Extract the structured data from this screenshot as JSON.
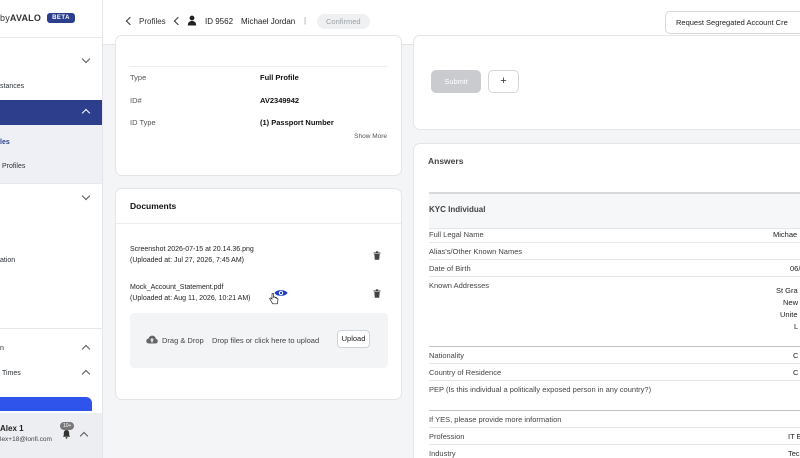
{
  "brand": {
    "prefix": "by",
    "name": "AVALO",
    "badge": "BETA"
  },
  "sidebar": {
    "items": [
      {
        "label": "stances"
      },
      {
        "label": "les"
      },
      {
        "label": "Profiles"
      },
      {
        "label": "ation"
      },
      {
        "label": "n"
      },
      {
        "label": "Times"
      }
    ],
    "user": {
      "name": "Alex 1",
      "email": "lex+18@lonfi.com",
      "notification_count": "10+"
    }
  },
  "topbar": {
    "back_label": "Profiles",
    "profile_id": "ID 9562",
    "profile_name": "Michael Jordan",
    "separator": "|",
    "status": "Confirmed",
    "request_button": "Request Segregated Account Cre"
  },
  "profile": {
    "fields": [
      {
        "label": "Type",
        "value": "Full Profile"
      },
      {
        "label": "ID#",
        "value": "AV2349942"
      },
      {
        "label": "ID Type",
        "value": "(1) Passport Number"
      }
    ],
    "show_more": "Show More"
  },
  "documents": {
    "title": "Documents",
    "files": [
      {
        "name": "Screenshot 2026-07-15 at 20.14.36.png",
        "uploaded": "(Uploaded at: Jul 27, 2026, 7:45 AM)"
      },
      {
        "name": "Mock_Account_Statement.pdf",
        "uploaded": "(Uploaded at: Aug 11, 2026, 10:21 AM)"
      }
    ],
    "dropzone_title": "Drag & Drop",
    "dropzone_hint": "Drop files or click here to upload",
    "upload_button": "Upload"
  },
  "actions": {
    "submit": "Submit",
    "add": "+"
  },
  "answers": {
    "title": "Answers",
    "section": "KYC Individual",
    "rows": [
      {
        "q": "Full Legal Name",
        "a": "Michae"
      },
      {
        "q": "Alias's/Other Known Names",
        "a": ""
      },
      {
        "q": "Date of Birth",
        "a": "06/"
      },
      {
        "q": "Known Addresses",
        "a": "St Gra"
      },
      {
        "q": "Nationality",
        "a": "C"
      },
      {
        "q": "Country of Residence",
        "a": "C"
      },
      {
        "q": "PEP (Is this individual a politically exposed person in any country?)",
        "a": ""
      },
      {
        "q": "If YES, please provide more information",
        "a": ""
      },
      {
        "q": "Profession",
        "a": "IT E"
      },
      {
        "q": "Industry",
        "a": "Tec"
      }
    ],
    "address_lines": [
      "New",
      "Unite",
      "L"
    ]
  },
  "colors": {
    "accent": "#2c3e8c",
    "primary_blue": "#2f54eb",
    "eye_icon": "#1f3fbf"
  }
}
